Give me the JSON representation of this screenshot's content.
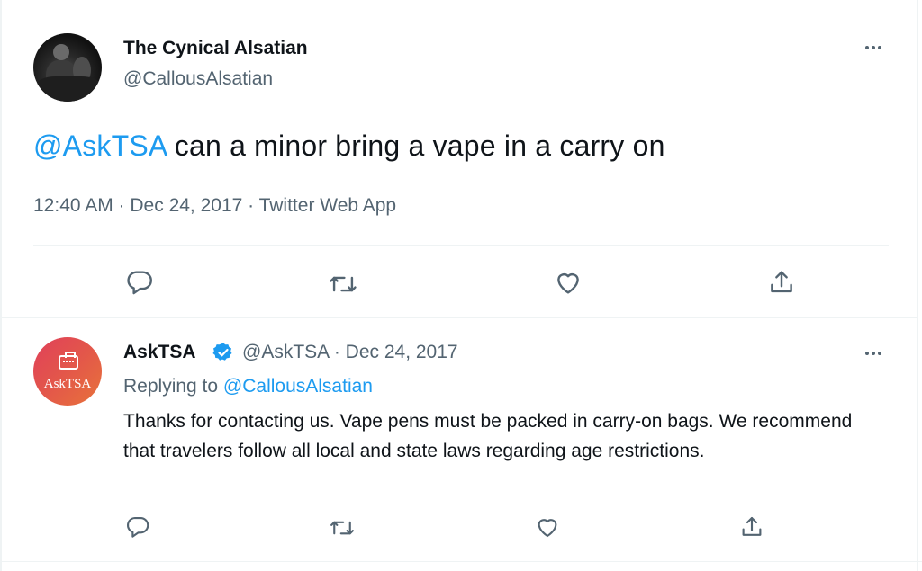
{
  "tweet": {
    "author_name": "The Cynical Alsatian",
    "author_handle": "@CallousAlsatian",
    "mention": "@AskTSA",
    "text": " can a minor bring a vape in a carry on",
    "timestamp": "12:40 AM · Dec 24, 2017 · Twitter Web App",
    "more_icon": "more-horizontal-icon",
    "actions": [
      "reply-icon",
      "retweet-icon",
      "like-icon",
      "share-icon"
    ]
  },
  "reply_tweet": {
    "author_name": "AskTSA",
    "avatar_text": "AskTSA",
    "verified_icon": "verified-badge-icon",
    "handle_date": "@AskTSA · Dec 24, 2017",
    "replying_prefix": "Replying to ",
    "replying_handle": "@CallousAlsatian",
    "text": "Thanks for contacting us. Vape pens must be packed in carry-on bags. We recommend that travelers follow all local and state laws regarding age restrictions.",
    "actions": [
      "reply-icon",
      "retweet-icon",
      "like-icon",
      "share-icon"
    ]
  },
  "colors": {
    "accent": "#1d9bf0",
    "text": "#0f1419",
    "muted": "#536471",
    "divider": "#eff3f4"
  }
}
